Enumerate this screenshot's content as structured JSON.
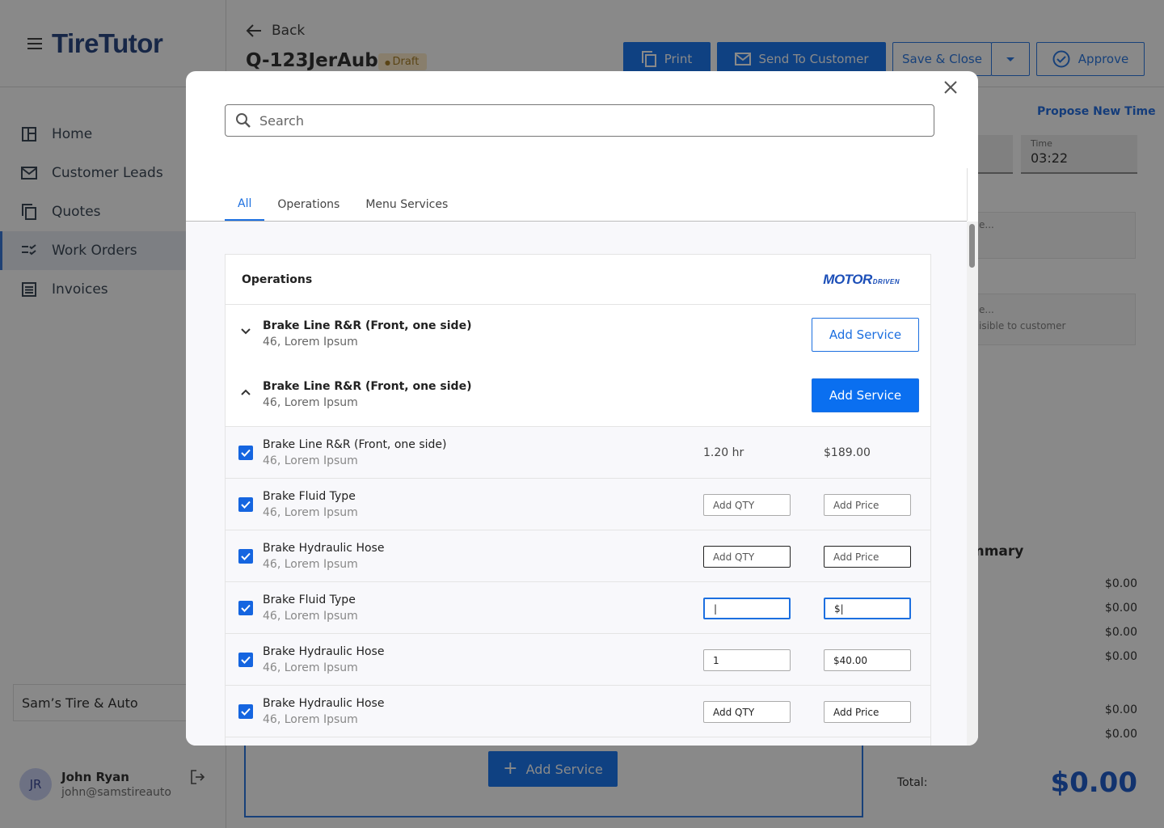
{
  "app": {
    "logo": "TireTutor",
    "nav": [
      {
        "label": "Home",
        "icon": "home-icon"
      },
      {
        "label": "Customer Leads",
        "icon": "mail-icon"
      },
      {
        "label": "Quotes",
        "icon": "copy-icon"
      },
      {
        "label": "Work Orders",
        "icon": "checklist-icon",
        "active": true
      },
      {
        "label": "Invoices",
        "icon": "list-icon"
      }
    ],
    "shop": "Sam’s Tire & Auto",
    "user": {
      "initials": "JR",
      "name": "John Ryan",
      "email": "john@samstireauto"
    }
  },
  "header": {
    "back": "Back",
    "quote_id": "Q-123JerAub",
    "status": "Draft",
    "print": "Print",
    "send": "Send To Customer",
    "save_close": "Save & Close",
    "approve": "Approve"
  },
  "background": {
    "propose": "Propose New Time",
    "time_label": "Time",
    "time_value": "03:22",
    "card1": "e...",
    "card2": "e...",
    "card2_sub": "isible to customer",
    "summary_title": "mmary",
    "summary_values": [
      "$0.00",
      "$0.00",
      "$0.00",
      "$0.00",
      "$0.00",
      "$0.00"
    ],
    "total_label": "Total:",
    "total_value": "$0.00",
    "add_service": "Add Service"
  },
  "modal": {
    "search_placeholder": "Search",
    "tabs": [
      "All",
      "Operations",
      "Menu Services"
    ],
    "active_tab": "All",
    "panel_title": "Operations",
    "brand": "MOTOR",
    "brand_sub": "DRIVEN",
    "groups": [
      {
        "name": "Brake Line R&R (Front, one side)",
        "sub": "46, Lorem Ipsum",
        "button": "Add Service",
        "expanded": false
      },
      {
        "name": "Brake Line R&R (Front, one side)",
        "sub": "46, Lorem Ipsum",
        "button": "Add Service",
        "expanded": true
      }
    ],
    "rows": [
      {
        "name": "Brake Line R&R (Front, one side)",
        "sub": "46, Lorem Ipsum",
        "qty": "1.20 hr",
        "price": "$189.00"
      },
      {
        "name": "Brake Fluid Type",
        "sub": "46, Lorem Ipsum",
        "qty": "Add QTY",
        "price": "Add Price"
      },
      {
        "name": "Brake Hydraulic Hose",
        "sub": "46, Lorem Ipsum",
        "qty": "Add QTY",
        "price": "Add Price"
      },
      {
        "name": "Brake Fluid Type",
        "sub": "46, Lorem Ipsum",
        "qty": "|",
        "price": "$|"
      },
      {
        "name": "Brake Hydraulic Hose",
        "sub": "46, Lorem Ipsum",
        "qty": "1",
        "price": "$40.00"
      },
      {
        "name": "Brake Hydraulic Hose",
        "sub": "46, Lorem Ipsum",
        "qty": "Add QTY",
        "price": "Add Price"
      }
    ]
  },
  "colors": {
    "primary": "#0a6ff0",
    "brand_navy": "#1a3a7a",
    "overlay": "rgba(20,20,20,0.5)"
  }
}
